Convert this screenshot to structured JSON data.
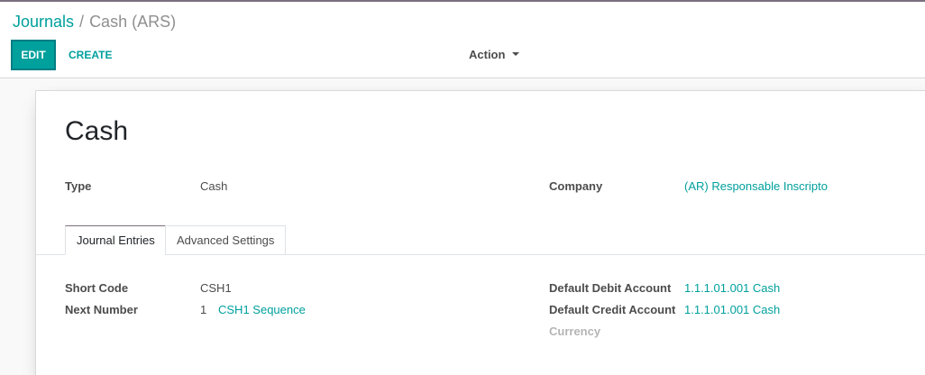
{
  "breadcrumb": {
    "parent": "Journals",
    "separator": "/",
    "current": "Cash (ARS)"
  },
  "toolbar": {
    "edit_label": "EDIT",
    "create_label": "CREATE",
    "action_label": "Action"
  },
  "record": {
    "title": "Cash",
    "type_label": "Type",
    "type_value": "Cash",
    "company_label": "Company",
    "company_value": "(AR) Responsable Inscripto"
  },
  "tabs": [
    {
      "label": "Journal Entries",
      "active": true
    },
    {
      "label": "Advanced Settings",
      "active": false
    }
  ],
  "journal_entries": {
    "short_code_label": "Short Code",
    "short_code_value": "CSH1",
    "next_number_label": "Next Number",
    "next_number_value": "1",
    "sequence_link": "CSH1 Sequence",
    "debit_label": "Default Debit Account",
    "debit_value": "1.1.1.01.001 Cash",
    "credit_label": "Default Credit Account",
    "credit_value": "1.1.1.01.001 Cash",
    "currency_label": "Currency"
  },
  "colors": {
    "brand": "#00a09d",
    "topbar": "#7c6f7f",
    "text": "#4c4c4c"
  }
}
